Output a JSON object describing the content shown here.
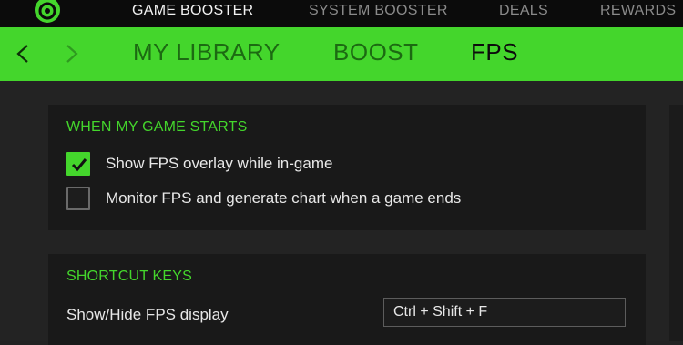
{
  "top_nav": {
    "tabs": [
      {
        "label": "GAME BOOSTER",
        "active": true
      },
      {
        "label": "SYSTEM BOOSTER",
        "active": false
      },
      {
        "label": "DEALS",
        "active": false
      },
      {
        "label": "REWARDS",
        "active": false
      }
    ],
    "logo_icon": "razer-cortex-logo-icon"
  },
  "sub_nav": {
    "back_icon": "chevron-left-icon",
    "forward_icon": "chevron-right-icon",
    "tabs": [
      {
        "label": "MY LIBRARY",
        "active": false
      },
      {
        "label": "BOOST",
        "active": false
      },
      {
        "label": "FPS",
        "active": true
      }
    ]
  },
  "game_starts": {
    "title": "WHEN MY GAME STARTS",
    "options": [
      {
        "label": "Show FPS overlay while in-game",
        "checked": true
      },
      {
        "label": "Monitor FPS and generate chart when a game ends",
        "checked": false
      }
    ]
  },
  "shortcut_keys": {
    "title": "SHORTCUT KEYS",
    "rows": [
      {
        "label": "Show/Hide FPS display",
        "value": "Ctrl + Shift + F"
      }
    ]
  },
  "colors": {
    "accent": "#44d62c",
    "background": "#222222",
    "panel": "#191919",
    "top_bar": "#0b0b0b"
  }
}
